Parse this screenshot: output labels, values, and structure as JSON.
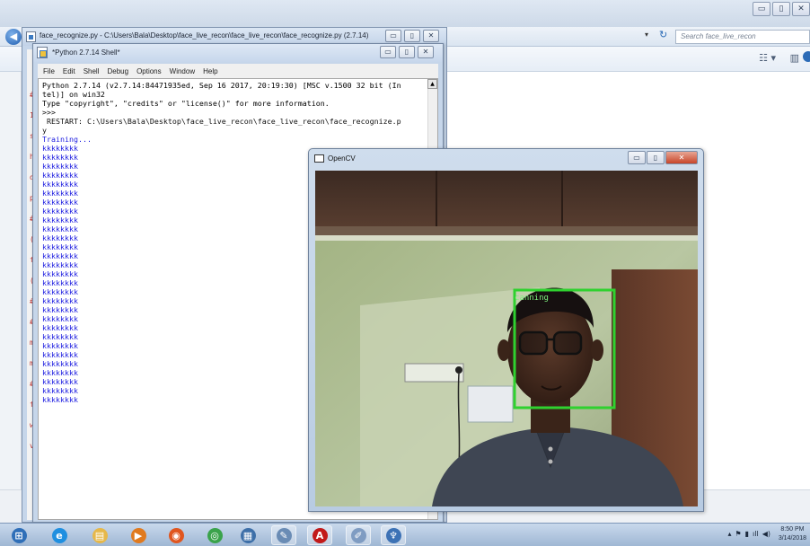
{
  "explorer": {
    "search_placeholder": "Search face_live_recon",
    "dropdown_glyph": "▾",
    "refresh_glyph": "↻",
    "views_glyph": "☷ ▾",
    "pane_glyph": "▥",
    "ctrl_min": "▭",
    "ctrl_max": "▯",
    "ctrl_close": "✕"
  },
  "editor": {
    "title": "face_recognize.py - C:\\Users\\Bala\\Desktop\\face_live_recon\\face_live_recon\\face_recognize.py (2.7.14)",
    "right_text": "B",
    "gutter_marks": [
      "#",
      "1",
      "s",
      "h",
      "d",
      "p",
      "#",
      "(",
      "f",
      "(",
      "#",
      "#",
      "m",
      "m",
      "#",
      "f",
      "w",
      "v"
    ]
  },
  "shell": {
    "title": "*Python 2.7.14 Shell*",
    "menu": [
      "File",
      "Edit",
      "Shell",
      "Debug",
      "Options",
      "Window",
      "Help"
    ],
    "header_lines": [
      "Python 2.7.14 (v2.7.14:84471935ed, Sep 16 2017, 20:19:30) [MSC v.1500 32 bit (In",
      "tel)] on win32",
      "Type \"copyright\", \"credits\" or \"license()\" for more information.",
      ">>>"
    ],
    "restart_lines": [
      " RESTART: C:\\Users\\Bala\\Desktop\\face_live_recon\\face_live_recon\\face_recognize.p",
      "y"
    ],
    "training": "Training...",
    "output_line": "kkkkkkkk",
    "output_count": 29
  },
  "opencv": {
    "title": "OpenCV",
    "overlay_label": "canning",
    "ctrl_min": "▭",
    "ctrl_max": "▯",
    "ctrl_close": "✕",
    "box_color": "#2fd12f"
  },
  "taskbar": {
    "items": [
      {
        "icon": "windows-start-icon",
        "glyph": "⊞",
        "color": "#2f6fb8"
      },
      {
        "icon": "internet-explorer-icon",
        "glyph": "e",
        "color": "#1f8fe0"
      },
      {
        "icon": "file-explorer-icon",
        "glyph": "▤",
        "color": "#e6b84a"
      },
      {
        "icon": "media-player-icon",
        "glyph": "▶",
        "color": "#e07a1f"
      },
      {
        "icon": "firefox-icon",
        "glyph": "◉",
        "color": "#e0561f"
      },
      {
        "icon": "chrome-icon",
        "glyph": "◎",
        "color": "#3aa34b"
      },
      {
        "icon": "network-icon",
        "glyph": "▦",
        "color": "#3d6fa8"
      },
      {
        "icon": "notepad-icon",
        "glyph": "✎",
        "color": "#6a8cb5"
      },
      {
        "icon": "acrobat-icon",
        "glyph": "A",
        "color": "#c21a1a"
      },
      {
        "icon": "paint-icon",
        "glyph": "✐",
        "color": "#7f9cc2"
      },
      {
        "icon": "python-icon",
        "glyph": "♆",
        "color": "#3d72b5"
      }
    ],
    "tray_glyphs": [
      "▴",
      "⚑",
      "▮",
      "ıll",
      "◀)"
    ],
    "clock_time": "8:50 PM",
    "clock_date": "3/14/2018"
  }
}
